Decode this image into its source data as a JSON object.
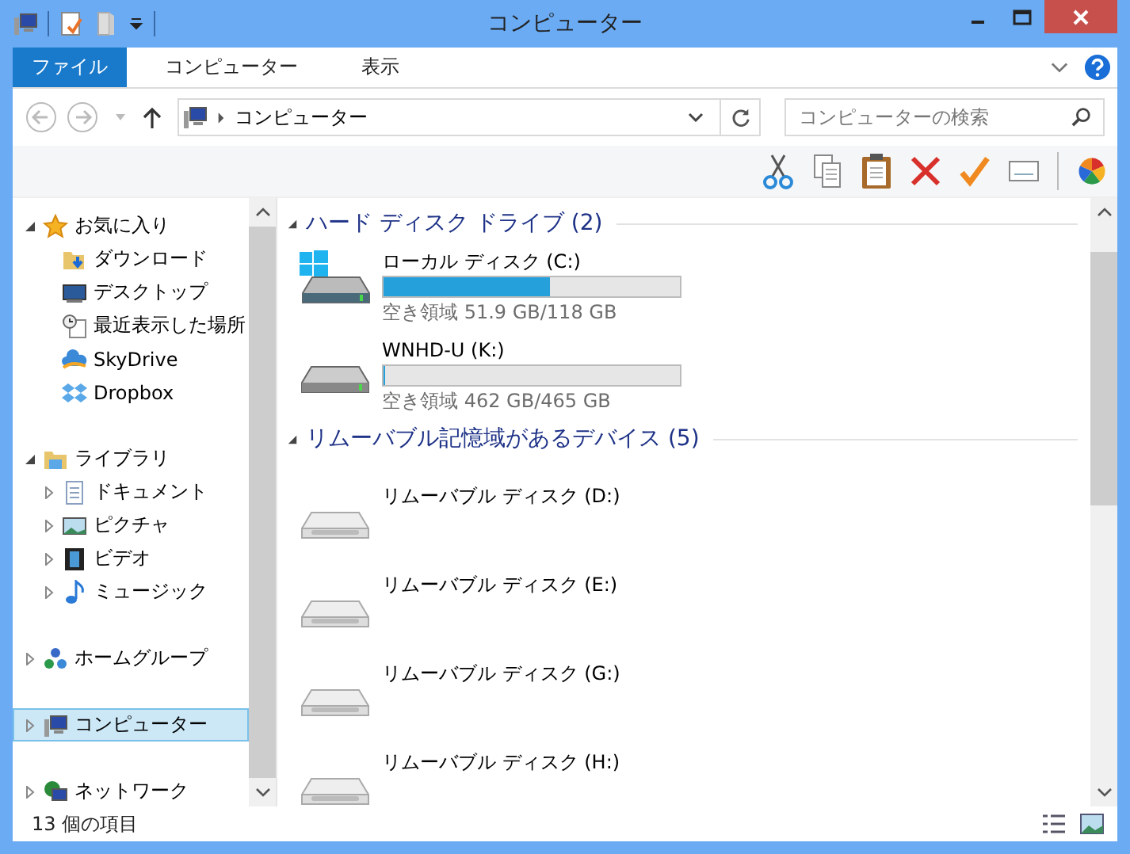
{
  "window": {
    "title": "コンピューター"
  },
  "ribbon_tabs": [
    {
      "label": "ファイル",
      "selected": true
    },
    {
      "label": "コンピューター",
      "selected": false
    },
    {
      "label": "表示",
      "selected": false
    }
  ],
  "address": {
    "path": [
      "コンピューター"
    ]
  },
  "search": {
    "placeholder": "コンピューターの検索"
  },
  "sidebar": {
    "groups": [
      {
        "label": "お気に入り",
        "kind": "star",
        "expanded": true,
        "selected": false,
        "children": [
          {
            "label": "ダウンロード",
            "kind": "download",
            "selected": false
          },
          {
            "label": "デスクトップ",
            "kind": "desktop",
            "selected": false
          },
          {
            "label": "最近表示した場所",
            "kind": "recent",
            "selected": false
          },
          {
            "label": "SkyDrive",
            "kind": "cloud",
            "selected": false
          },
          {
            "label": "Dropbox",
            "kind": "box",
            "selected": false
          }
        ]
      },
      {
        "label": "ライブラリ",
        "kind": "library",
        "expanded": true,
        "selected": false,
        "children": [
          {
            "label": "ドキュメント",
            "kind": "document",
            "expanded": false,
            "selected": false
          },
          {
            "label": "ピクチャ",
            "kind": "picture",
            "expanded": false,
            "selected": false
          },
          {
            "label": "ビデオ",
            "kind": "video",
            "expanded": false,
            "selected": false
          },
          {
            "label": "ミュージック",
            "kind": "music",
            "expanded": false,
            "selected": false
          }
        ]
      },
      {
        "label": "ホームグループ",
        "kind": "homegroup",
        "expanded": false,
        "selected": false
      },
      {
        "label": "コンピューター",
        "kind": "computer",
        "expanded": false,
        "selected": true
      },
      {
        "label": "ネットワーク",
        "kind": "network",
        "expanded": false,
        "selected": false
      }
    ]
  },
  "sections": [
    {
      "title": "ハード ディスク ドライブ (2)",
      "expanded": true,
      "drives": [
        {
          "name": "ローカル ディスク (C:)",
          "kind": "system",
          "level": 0.56,
          "free": "空き領域 51.9 GB/118 GB"
        },
        {
          "name": "WNHD-U (K:)",
          "kind": "hdd",
          "level": 0.006,
          "free": "空き領域 462 GB/465 GB"
        }
      ]
    },
    {
      "title": "リムーバブル記憶域があるデバイス (5)",
      "expanded": true,
      "drives": [
        {
          "name": "リムーバブル ディスク (D:)",
          "kind": "removable"
        },
        {
          "name": "リムーバブル ディスク (E:)",
          "kind": "removable"
        },
        {
          "name": "リムーバブル ディスク (G:)",
          "kind": "removable"
        },
        {
          "name": "リムーバブル ディスク (H:)",
          "kind": "removable"
        }
      ]
    }
  ],
  "status_bar": {
    "count": "13 個の項目"
  }
}
